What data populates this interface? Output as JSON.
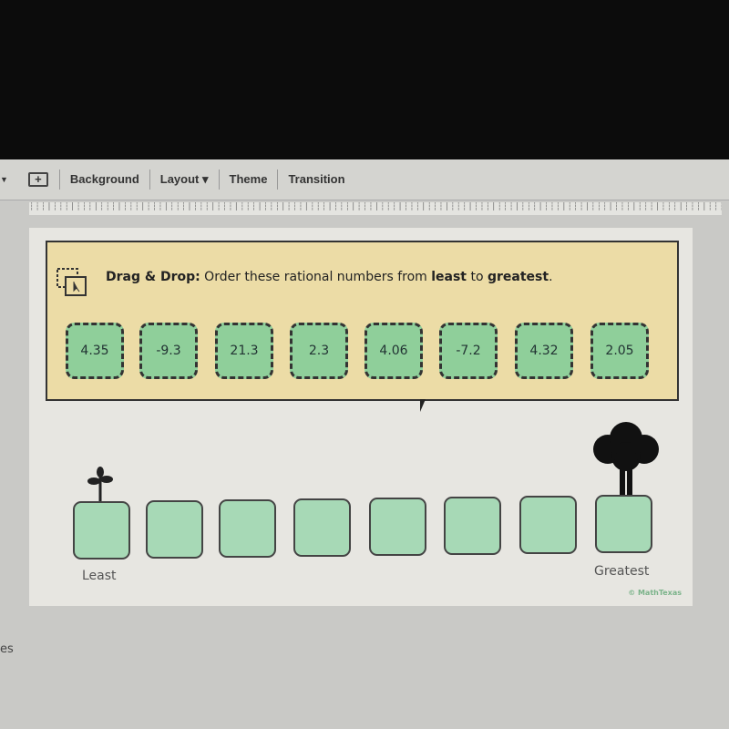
{
  "toolbar": {
    "items": [
      "Background",
      "Layout",
      "Theme",
      "Transition"
    ]
  },
  "slide": {
    "instruction_bold": "Drag & Drop:",
    "instruction_pre": " Order these rational numbers from ",
    "instruction_least": "least",
    "instruction_mid": " to ",
    "instruction_greatest": "greatest",
    "instruction_end": ".",
    "cards": [
      "4.35",
      "-9.3",
      "21.3",
      "2.3",
      "4.06",
      "-7.2",
      "4.32",
      "2.05"
    ],
    "slot_count": 8,
    "least_label": "Least",
    "greatest_label": "Greatest",
    "credit": "© MathTexas"
  },
  "side_text": "es",
  "colors": {
    "card": "#8fcf9a",
    "slot": "#a7d9b6",
    "prompt_bg": "#ecdca6"
  }
}
